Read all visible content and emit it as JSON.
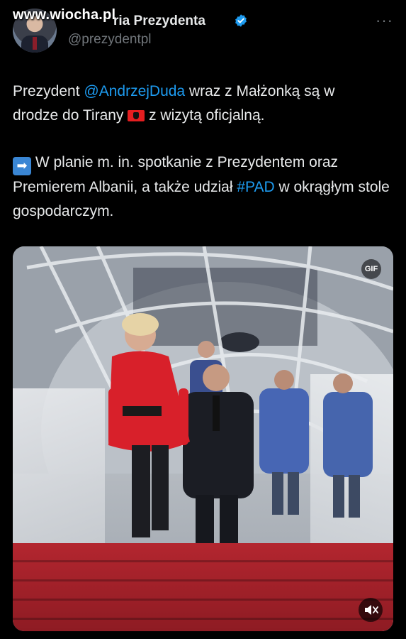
{
  "header": {
    "watermark": "www.wiocha.pl",
    "display_name": "Kancelaria Prezydenta",
    "display_name_visible": "ria Prezydenta",
    "handle": "@prezydentpl",
    "more_label": "···",
    "verified_color": "#1d9bf0"
  },
  "tweet": {
    "line1_pre": "Prezydent ",
    "mention": "@AndrzejDuda",
    "line1_post": " wraz z Małżonką są w",
    "line2_pre": "drodze do Tirany ",
    "line2_post": " z wizytą oficjalną.",
    "para2_pre": " W planie m. in. spotkanie z Prezydentem oraz Premierem Albanii, a także udział ",
    "hashtag": "#PAD",
    "para2_post": " w okrągłym stole gospodarczym.",
    "flag_icon": "albania-flag-icon",
    "arrow_icon": "right-arrow-emoji-icon",
    "link_color": "#1d9bf0"
  },
  "media": {
    "gif_label": "GIF",
    "mute_icon": "volume-muted-icon"
  }
}
